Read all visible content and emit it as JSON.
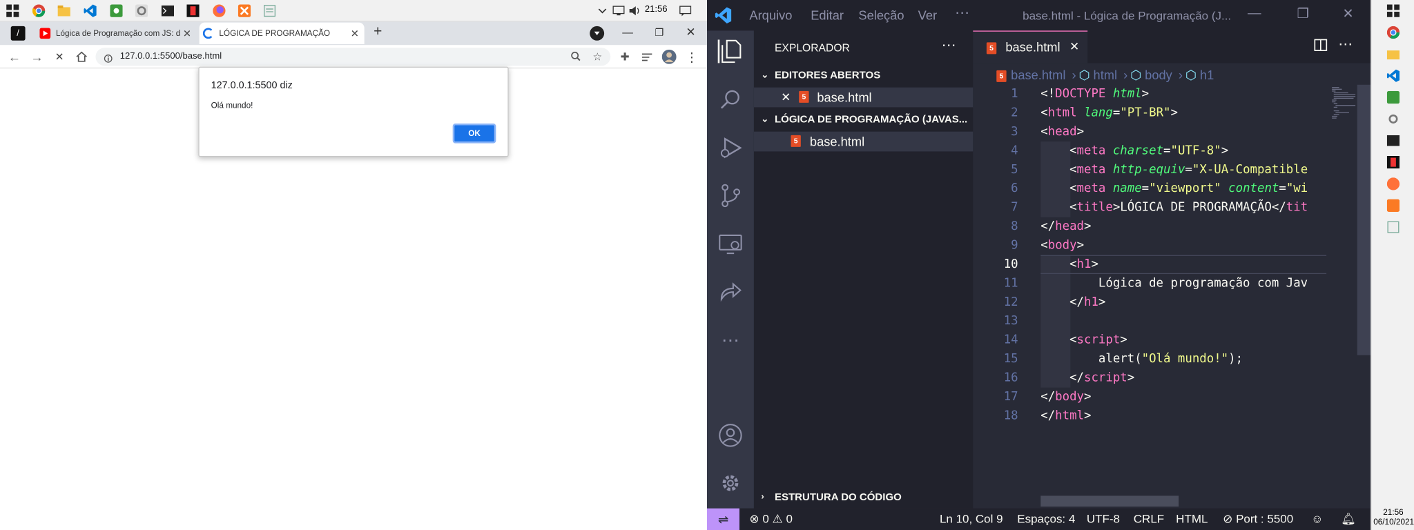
{
  "taskbar": {
    "time": "21:56"
  },
  "browser": {
    "tabs": [
      {
        "label": "Lógica de Programação com JS: d"
      },
      {
        "label": "LÓGICA DE PROGRAMAÇÃO"
      }
    ],
    "url": "127.0.0.1:5500/base.html",
    "dialog": {
      "title": "127.0.0.1:5500 diz",
      "message": "Olá mundo!",
      "ok": "OK"
    }
  },
  "vscode": {
    "menu": [
      "Arquivo",
      "Editar",
      "Seleção",
      "Ver"
    ],
    "title": "base.html - Lógica de Programação (J...",
    "sidebar": {
      "header": "EXPLORADOR",
      "open_editors": "EDITORES ABERTOS",
      "open_file": "base.html",
      "folder": "LÓGICA DE PROGRAMAÇÃO (JAVAS...",
      "folder_file": "base.html",
      "outline": "ESTRUTURA DO CÓDIGO"
    },
    "tab": "base.html",
    "breadcrumb": [
      "base.html",
      "html",
      "body",
      "h1"
    ],
    "current_line": 10,
    "code": [
      [
        [
          "pu",
          "<!"
        ],
        [
          "tg",
          "DOCTYPE "
        ],
        [
          "at",
          "html"
        ],
        [
          "pu",
          ">"
        ]
      ],
      [
        [
          "pu",
          "<"
        ],
        [
          "tg",
          "html "
        ],
        [
          "at",
          "lang"
        ],
        [
          "pu",
          "="
        ],
        [
          "st",
          "\"PT-BR\""
        ],
        [
          "pu",
          ">"
        ]
      ],
      [
        [
          "pu",
          "<"
        ],
        [
          "tg",
          "head"
        ],
        [
          "pu",
          ">"
        ]
      ],
      [
        [
          "pu",
          "    <"
        ],
        [
          "tg",
          "meta "
        ],
        [
          "at",
          "charset"
        ],
        [
          "pu",
          "="
        ],
        [
          "st",
          "\"UTF-8\""
        ],
        [
          "pu",
          ">"
        ]
      ],
      [
        [
          "pu",
          "    <"
        ],
        [
          "tg",
          "meta "
        ],
        [
          "at",
          "http-equiv"
        ],
        [
          "pu",
          "="
        ],
        [
          "st",
          "\"X-UA-Compatible"
        ]
      ],
      [
        [
          "pu",
          "    <"
        ],
        [
          "tg",
          "meta "
        ],
        [
          "at",
          "name"
        ],
        [
          "pu",
          "="
        ],
        [
          "st",
          "\"viewport\" "
        ],
        [
          "at",
          "content"
        ],
        [
          "pu",
          "="
        ],
        [
          "st",
          "\"wi"
        ]
      ],
      [
        [
          "pu",
          "    <"
        ],
        [
          "tg",
          "title"
        ],
        [
          "pu",
          ">LÓGICA DE PROGRAMAÇÃO</"
        ],
        [
          "tg",
          "tit"
        ]
      ],
      [
        [
          "pu",
          "</"
        ],
        [
          "tg",
          "head"
        ],
        [
          "pu",
          ">"
        ]
      ],
      [
        [
          "pu",
          "<"
        ],
        [
          "tg",
          "body"
        ],
        [
          "pu",
          ">"
        ]
      ],
      [
        [
          "pu",
          "    <"
        ],
        [
          "tg",
          "h1"
        ],
        [
          "pu",
          ">"
        ]
      ],
      [
        [
          "pu",
          "        Lógica de programação com Jav"
        ]
      ],
      [
        [
          "pu",
          "    </"
        ],
        [
          "tg",
          "h1"
        ],
        [
          "pu",
          ">"
        ]
      ],
      [
        [
          "pu",
          ""
        ]
      ],
      [
        [
          "pu",
          "    <"
        ],
        [
          "tg",
          "script"
        ],
        [
          "pu",
          ">"
        ]
      ],
      [
        [
          "pu",
          "        alert("
        ],
        [
          "st",
          "\"Olá mundo!\""
        ],
        [
          "pu",
          ");"
        ]
      ],
      [
        [
          "pu",
          "    </"
        ],
        [
          "tg",
          "script"
        ],
        [
          "pu",
          ">"
        ]
      ],
      [
        [
          "pu",
          "</"
        ],
        [
          "tg",
          "body"
        ],
        [
          "pu",
          ">"
        ]
      ],
      [
        [
          "pu",
          "</"
        ],
        [
          "tg",
          "html"
        ],
        [
          "pu",
          ">"
        ]
      ]
    ],
    "status": {
      "errors": "0",
      "warnings": "0",
      "position": "Ln 10, Col 9",
      "spaces": "Espaços: 4",
      "encoding": "UTF-8",
      "eol": "CRLF",
      "language": "HTML",
      "port": "Port : 5500"
    }
  },
  "right_taskbar": {
    "time": "21:56",
    "date": "06/10/2021"
  }
}
